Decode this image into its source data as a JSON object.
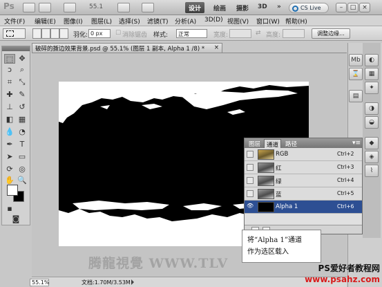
{
  "app": {
    "logo": "Ps",
    "zoom": "55.1",
    "workspaces": [
      "设计",
      "绘画",
      "摄影",
      "3D"
    ],
    "more": "»",
    "cslive": "CS Live"
  },
  "menu": [
    "文件(F)",
    "编辑(E)",
    "图像(I)",
    "图层(L)",
    "选择(S)",
    "滤镜(T)",
    "分析(A)",
    "3D(D)",
    "视图(V)",
    "窗口(W)",
    "帮助(H)"
  ],
  "options": {
    "feather_label": "羽化:",
    "feather_value": "0 px",
    "antialias_label": "消除锯齿",
    "style_label": "样式:",
    "style_value": "正常",
    "width_label": "宽度:",
    "height_label": "高度:",
    "refine_button": "调整边缘..."
  },
  "document": {
    "tab_title": "破碎的撕边效果背景.psd @ 55.1% (图层 1 副本, Alpha 1 /8) *",
    "close": "×",
    "watermark": "腾龍視覺 WWW.TLV"
  },
  "status": {
    "zoom": "55.1%",
    "doc_info": "文档:1.70M/3.53M"
  },
  "channels_panel": {
    "tabs": [
      "图层",
      "通道",
      "路径"
    ],
    "active_tab": "通道",
    "menu": "▾≡",
    "rows": [
      {
        "name": "RGB",
        "shortcut": "Ctrl+2",
        "thumb": "rgb",
        "visible": false,
        "selected": false
      },
      {
        "name": "红",
        "shortcut": "Ctrl+3",
        "thumb": "gray",
        "visible": false,
        "selected": false
      },
      {
        "name": "绿",
        "shortcut": "Ctrl+4",
        "thumb": "gray",
        "visible": false,
        "selected": false
      },
      {
        "name": "蓝",
        "shortcut": "Ctrl+5",
        "thumb": "gray",
        "visible": false,
        "selected": false
      },
      {
        "name": "Alpha 1",
        "shortcut": "Ctrl+6",
        "thumb": "alpha",
        "visible": true,
        "selected": true
      }
    ]
  },
  "callout": {
    "line1": "将“Alpha 1”通道",
    "line2": "作为选区载入"
  },
  "site": {
    "title": "PS爱好者教程网",
    "url": "www.psahz.com"
  },
  "colors": {
    "selected_row": "#2d4f93",
    "active_workspace": "#3e3e3e",
    "site_url": "#d81b1b"
  }
}
